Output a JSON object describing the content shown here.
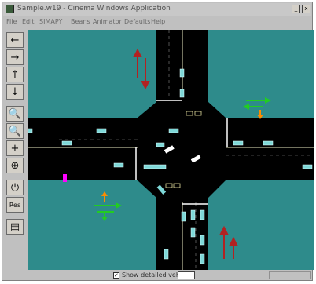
{
  "window": {
    "title": "Sample.w19 - Cinema Windows Application",
    "min_label": "_",
    "close_label": "x"
  },
  "menu": [
    "File",
    "Edit",
    "SIMAPY",
    "Beans",
    "Animator",
    "Defaults",
    "Help"
  ],
  "toolbar": [
    {
      "name": "arrow-left-button",
      "icon": "left-arrow-icon",
      "glyph": "←"
    },
    {
      "name": "arrow-right-button",
      "icon": "right-arrow-icon",
      "glyph": "→"
    },
    {
      "name": "arrow-up-button",
      "icon": "up-arrow-icon",
      "glyph": "↑"
    },
    {
      "name": "arrow-down-button",
      "icon": "down-arrow-icon",
      "glyph": "↓"
    },
    {
      "name": "zoom-in-button",
      "icon": "magnifier-icon",
      "glyph": "🔍"
    },
    {
      "name": "zoom-out-button",
      "icon": "magnifier-icon",
      "glyph": "🔍"
    },
    {
      "name": "pan-button",
      "icon": "crosshair-icon",
      "glyph": "+"
    },
    {
      "name": "center-button",
      "icon": "target-icon",
      "glyph": "⊕"
    },
    {
      "name": "power-button",
      "icon": "power-icon",
      "glyph": "⏻"
    },
    {
      "name": "reset-button",
      "icon": "reset-icon",
      "glyph": "Res"
    },
    {
      "name": "settings-button",
      "icon": "panel-icon",
      "glyph": "▤"
    }
  ],
  "status": {
    "checkbox_checked": true,
    "checkbox_mark": "✓",
    "checkbox_label": "Show detailed vehicles"
  },
  "colors": {
    "grass": "#2e8b8b",
    "road": "#000000",
    "vehicle": "#7fd8d8",
    "signal_red": "#b22222",
    "signal_green": "#22cc22",
    "signal_orange": "#ff8c00",
    "special_vehicle": "#ff00ff"
  }
}
